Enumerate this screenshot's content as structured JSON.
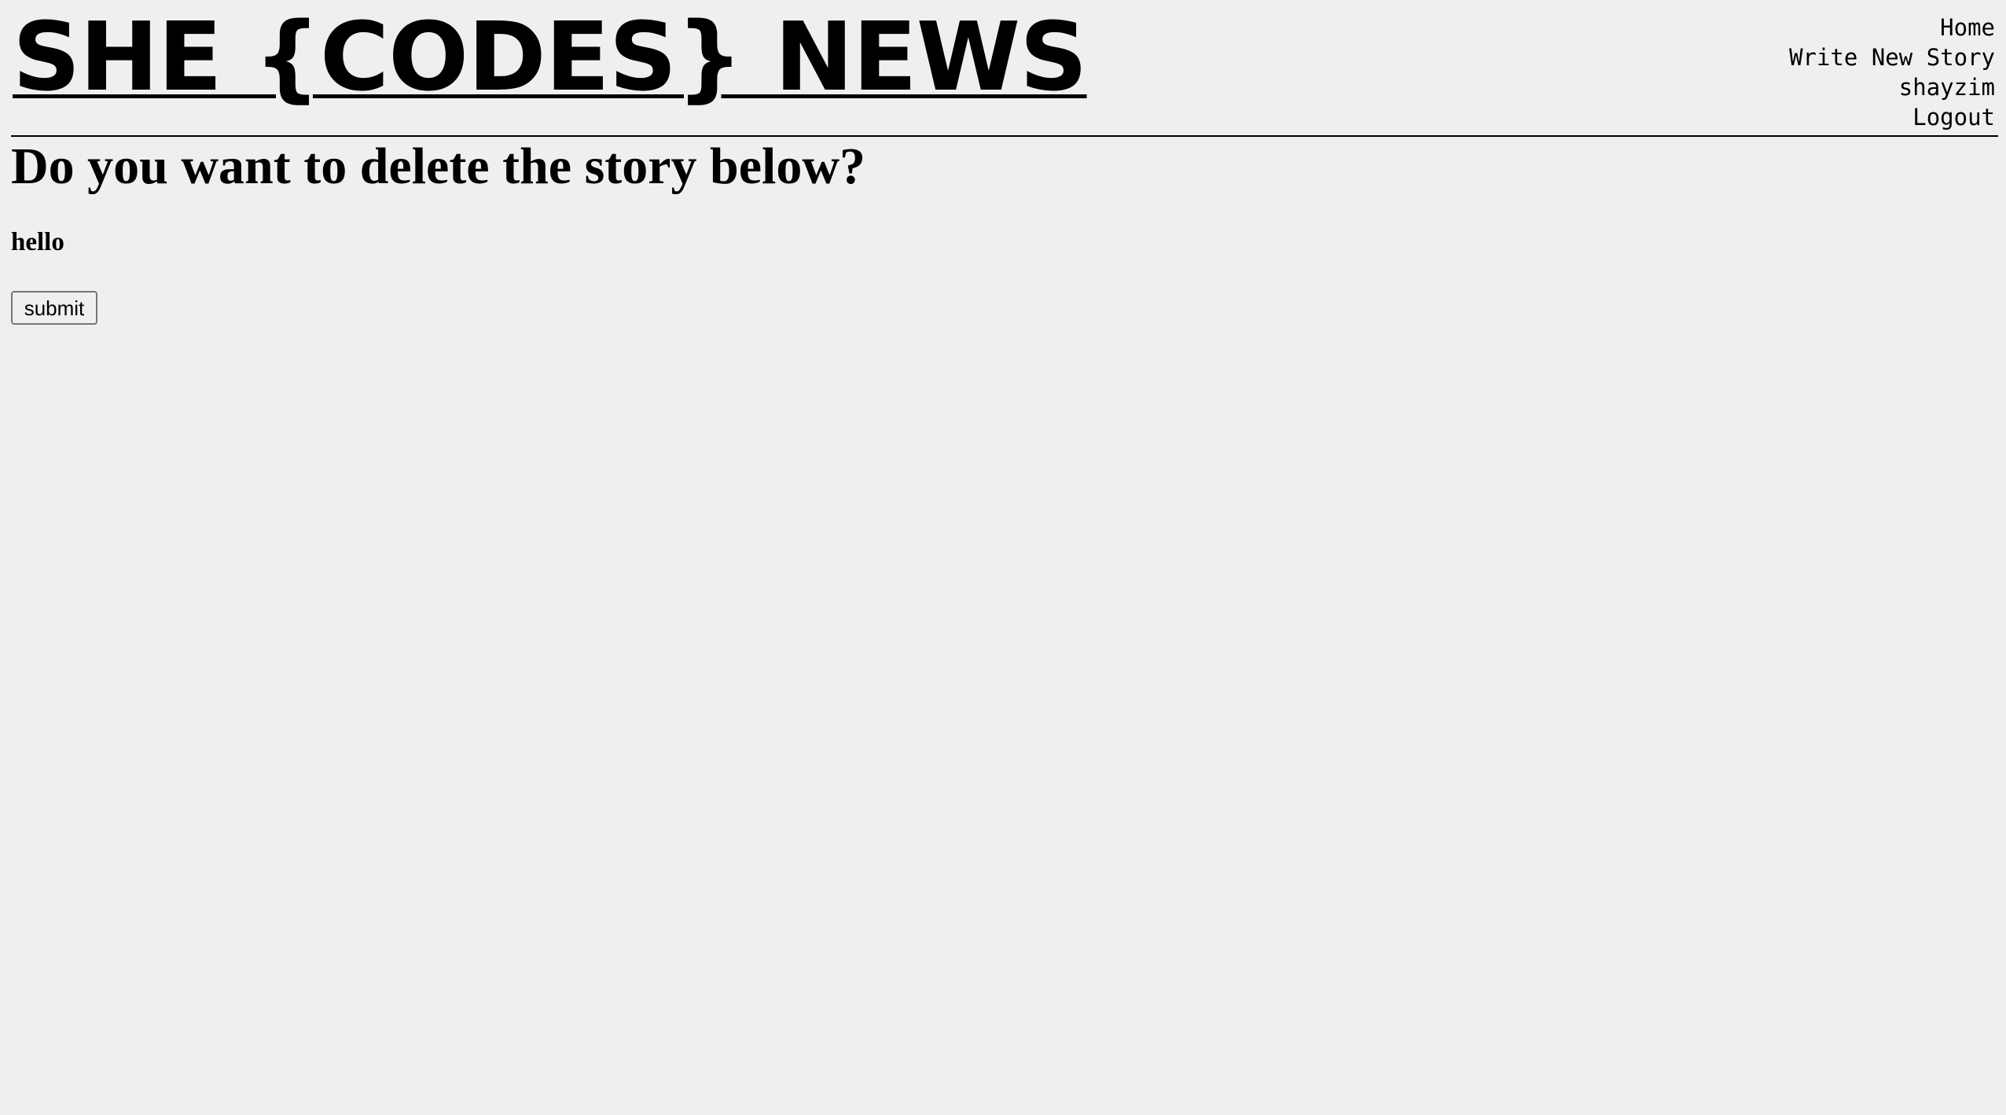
{
  "header": {
    "site_title": "SHE {CODES} NEWS",
    "nav": {
      "home": "Home",
      "write_new_story": "Write New Story",
      "username": "shayzim",
      "logout": "Logout"
    }
  },
  "main": {
    "heading": "Do you want to delete the story below?",
    "story_title": "hello",
    "submit_label": "submit"
  }
}
